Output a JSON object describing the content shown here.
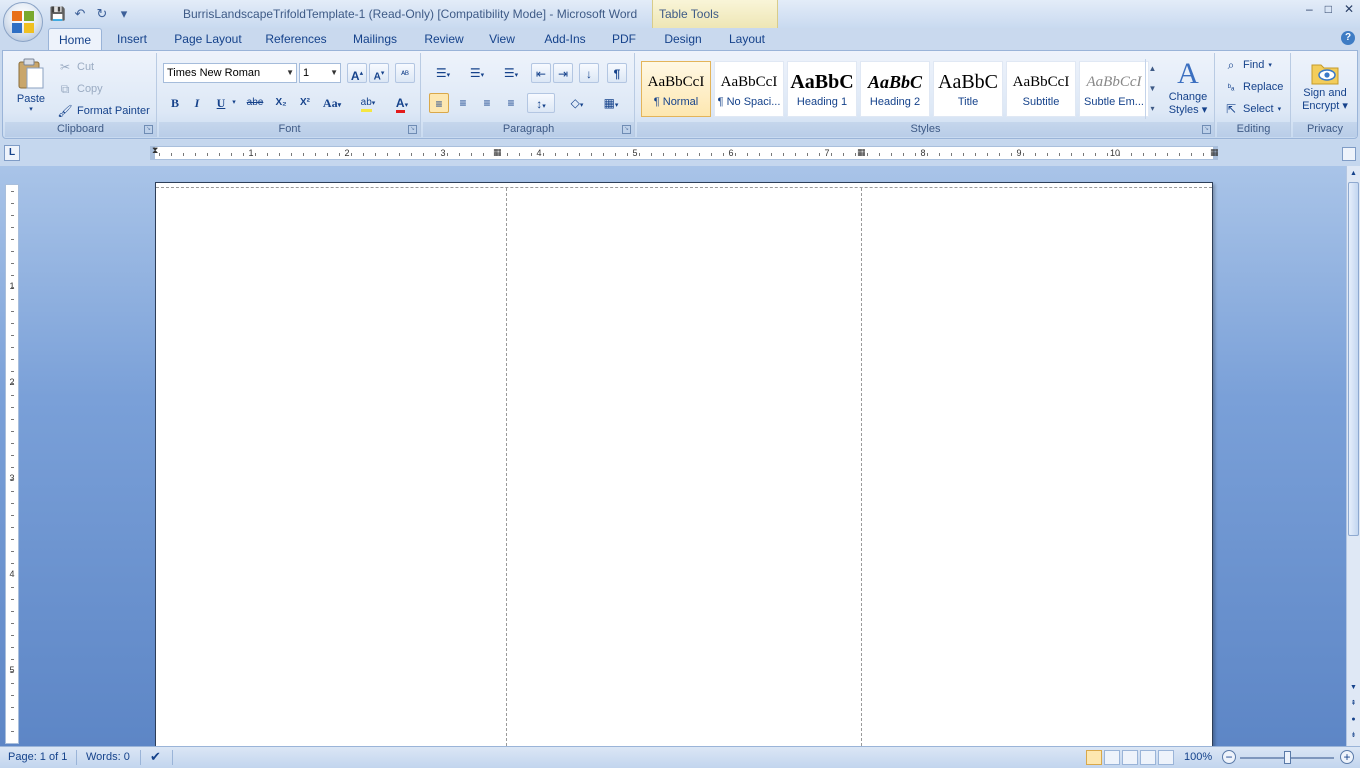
{
  "window": {
    "title": "BurrisLandscapeTrifoldTemplate-1 (Read-Only) [Compatibility Mode] - Microsoft Word",
    "contextual_tab_group": "Table Tools",
    "controls": {
      "minimize": "–",
      "maximize": "□",
      "close": "✕"
    }
  },
  "quick_access": {
    "save_icon": "💾",
    "undo_icon": "↶",
    "redo_icon": "↻",
    "customize_icon": "▾"
  },
  "tabs": [
    {
      "label": "Home",
      "active": true
    },
    {
      "label": "Insert"
    },
    {
      "label": "Page Layout"
    },
    {
      "label": "References"
    },
    {
      "label": "Mailings"
    },
    {
      "label": "Review"
    },
    {
      "label": "View"
    },
    {
      "label": "Add-Ins"
    },
    {
      "label": "PDF"
    },
    {
      "label": "Design"
    },
    {
      "label": "Layout"
    }
  ],
  "help_glyph": "?",
  "clipboard": {
    "label": "Clipboard",
    "paste": "Paste",
    "cut": "Cut",
    "copy": "Copy",
    "format_painter": "Format Painter"
  },
  "font": {
    "label": "Font",
    "family": "Times New Roman",
    "size": "1",
    "grow_glyph": "A",
    "shrink_glyph": "A",
    "clear_glyph": "ᴬᴮ",
    "bold": "B",
    "italic": "I",
    "underline": "U",
    "strike": "abe",
    "subscript": "X₂",
    "superscript": "X²",
    "change_case": "Aa",
    "highlight_glyph": "ab",
    "font_color_glyph": "A",
    "highlight_color": "#f5e642",
    "font_color": "#e31b1b"
  },
  "paragraph": {
    "label": "Paragraph",
    "bullets_icon": "☰",
    "numbering_icon": "☰",
    "multilevel_icon": "☰",
    "decrease_indent_icon": "⇤",
    "increase_indent_icon": "⇥",
    "sort_icon": "↓",
    "show_marks": "¶",
    "align_left_icon": "≡",
    "center_icon": "≡",
    "align_right_icon": "≡",
    "justify_icon": "≡",
    "line_spacing_icon": "↕",
    "shading_icon": "◇",
    "borders_icon": "▦"
  },
  "styles": {
    "label": "Styles",
    "items": [
      {
        "sample": "AaBbCcI",
        "name": "¶ Normal",
        "selected": true
      },
      {
        "sample": "AaBbCcI",
        "name": "¶ No Spaci..."
      },
      {
        "sample": "AaBbC",
        "name": "Heading 1"
      },
      {
        "sample": "AaBbC",
        "name": "Heading 2"
      },
      {
        "sample": "AaBbC",
        "name": "Title"
      },
      {
        "sample": "AaBbCcI",
        "name": "Subtitle"
      },
      {
        "sample": "AaBbCcI",
        "name": "Subtle Em..."
      }
    ],
    "change_styles_line1": "Change",
    "change_styles_line2": "Styles"
  },
  "editing": {
    "label": "Editing",
    "find": "Find",
    "replace": "Replace",
    "select": "Select"
  },
  "privacy": {
    "label": "Privacy",
    "sign_line1": "Sign and",
    "sign_line2": "Encrypt"
  },
  "ruler": {
    "corner_glyph": "L",
    "numbers": [
      "1",
      "2",
      "3",
      "4",
      "5",
      "6",
      "7",
      "8",
      "9",
      "10"
    ],
    "vertical_numbers": [
      "1",
      "2",
      "3",
      "4",
      "5"
    ]
  },
  "status": {
    "page": "Page: 1 of 1",
    "words": "Words: 0",
    "zoom": "100%",
    "zoom_out": "−",
    "zoom_in": "+"
  }
}
